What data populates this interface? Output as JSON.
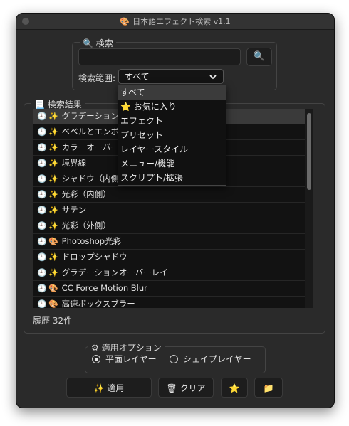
{
  "window": {
    "title": "日本語エフェクト検索 v1.1",
    "title_icon": "🎨"
  },
  "search": {
    "legend": "検索",
    "legend_icon": "🔍",
    "input_value": "",
    "button_icon": "🔍",
    "scope_label": "検索範囲:",
    "scope_value": "すべて",
    "scope_options": [
      "すべて",
      "お気に入り",
      "エフェクト",
      "プリセット",
      "レイヤースタイル",
      "メニュー/機能",
      "スクリプト/拡張"
    ],
    "favorite_icon": "⭐"
  },
  "results": {
    "legend": "検索結果",
    "legend_icon": "📃",
    "items": [
      {
        "icon": "🕘",
        "type_icon": "✨",
        "label": "グラデーションオーバーレイ"
      },
      {
        "icon": "🕘",
        "type_icon": "✨",
        "label": "ベベルとエンボス"
      },
      {
        "icon": "🕘",
        "type_icon": "✨",
        "label": "カラーオーバーレイ"
      },
      {
        "icon": "🕘",
        "type_icon": "✨",
        "label": "境界線"
      },
      {
        "icon": "🕘",
        "type_icon": "✨",
        "label": "シャドウ（内側）"
      },
      {
        "icon": "🕘",
        "type_icon": "✨",
        "label": "光彩（内側）"
      },
      {
        "icon": "🕘",
        "type_icon": "✨",
        "label": "サテン"
      },
      {
        "icon": "🕘",
        "type_icon": "✨",
        "label": "光彩（外側）"
      },
      {
        "icon": "🕘",
        "type_icon": "🎨",
        "label": "Photoshop光彩"
      },
      {
        "icon": "🕘",
        "type_icon": "✨",
        "label": "ドロップシャドウ"
      },
      {
        "icon": "🕘",
        "type_icon": "✨",
        "label": "グラデーションオーバーレイ"
      },
      {
        "icon": "🕘",
        "type_icon": "🎨",
        "label": "CC Force Motion Blur"
      },
      {
        "icon": "🕘",
        "type_icon": "🎨",
        "label": "高速ボックスブラー"
      },
      {
        "icon": "🕘",
        "type_icon": "✨",
        "label": ""
      }
    ],
    "history": "履歴 32件"
  },
  "options": {
    "legend": "適用オプション",
    "legend_icon": "⚙",
    "radio1": "平面レイヤー",
    "radio2": "シェイプレイヤー",
    "selected": "平面レイヤー"
  },
  "buttons": {
    "apply": "✨ 適用",
    "clear": "🗑 クリア",
    "favorite": "⭐",
    "folder": "📁"
  }
}
